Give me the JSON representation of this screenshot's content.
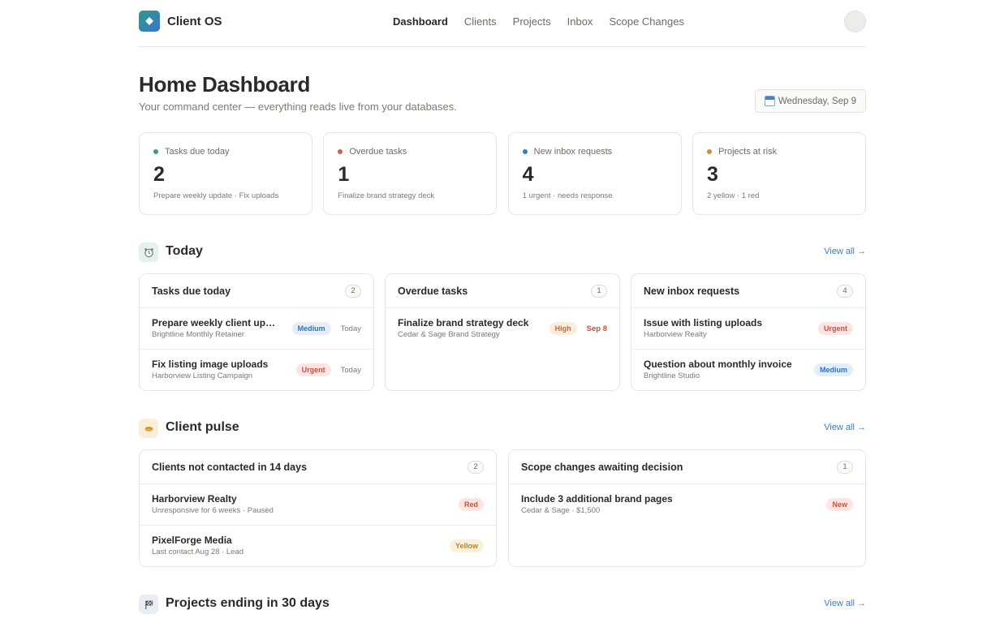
{
  "app": {
    "name": "Client OS"
  },
  "nav": {
    "items": [
      "Dashboard",
      "Clients",
      "Projects",
      "Inbox",
      "Scope Changes"
    ],
    "active": "Dashboard"
  },
  "header": {
    "title": "Home Dashboard",
    "subtitle": "Your command center — everything reads live from your databases.",
    "date": "Wednesday, Sep 9"
  },
  "colors": {
    "green": "#3f9c6b",
    "red": "#d0604a",
    "blue": "#2f7fd0",
    "orange": "#d4873d"
  },
  "stats": [
    {
      "label": "Tasks due today",
      "value": "2",
      "note": "Prepare weekly update · Fix uploads",
      "color": "#3f9c6b"
    },
    {
      "label": "Overdue tasks",
      "value": "1",
      "note": "Finalize brand strategy deck",
      "color": "#d0604a"
    },
    {
      "label": "New inbox requests",
      "value": "4",
      "note": "1 urgent · needs response",
      "color": "#2f7fd0"
    },
    {
      "label": "Projects at risk",
      "value": "3",
      "note": "2 yellow · 1 red",
      "color": "#d4873d"
    }
  ],
  "sections": {
    "today": {
      "title": "Today",
      "view_all": "View all →",
      "icon": "alarm-clock-icon"
    },
    "pulse": {
      "title": "Client pulse",
      "view_all": "View all →",
      "icon": "handshake-icon"
    },
    "ending": {
      "title": "Projects ending in 30 days",
      "view_all": "View all →",
      "icon": "checkered-flag-icon"
    }
  },
  "today": {
    "due": {
      "title": "Tasks due today",
      "count": "2",
      "rows": [
        {
          "title": "Prepare weekly client up…",
          "sub": "Brightline Monthly Retainer",
          "badge": "Medium",
          "due": "Today"
        },
        {
          "title": "Fix listing image uploads",
          "sub": "Harborview Listing Campaign",
          "badge": "Urgent",
          "due": "Today"
        }
      ]
    },
    "overdue": {
      "title": "Overdue tasks",
      "count": "1",
      "rows": [
        {
          "title": "Finalize brand strategy deck",
          "sub": "Cedar & Sage Brand Strategy",
          "badge": "High",
          "due": "Sep 8"
        }
      ]
    },
    "inbox": {
      "title": "New inbox requests",
      "count": "4",
      "rows": [
        {
          "title": "Issue with listing uploads",
          "sub": "Harborview Realty",
          "badge": "Urgent"
        },
        {
          "title": "Question about monthly invoice",
          "sub": "Brightline Studio",
          "badge": "Medium"
        }
      ]
    }
  },
  "pulse": {
    "not_contacted": {
      "title": "Clients not contacted in 14 days",
      "count": "2",
      "rows": [
        {
          "title": "Harborview Realty",
          "sub": "Unresponsive for 6 weeks · Paused",
          "badge": "Red"
        },
        {
          "title": "PixelForge Media",
          "sub": "Last contact Aug 28 · Lead",
          "badge": "Yellow"
        }
      ]
    },
    "scope": {
      "title": "Scope changes awaiting decision",
      "count": "1",
      "rows": [
        {
          "title": "Include 3 additional brand pages",
          "sub": "Cedar & Sage · $1,500",
          "badge": "New"
        }
      ]
    }
  }
}
